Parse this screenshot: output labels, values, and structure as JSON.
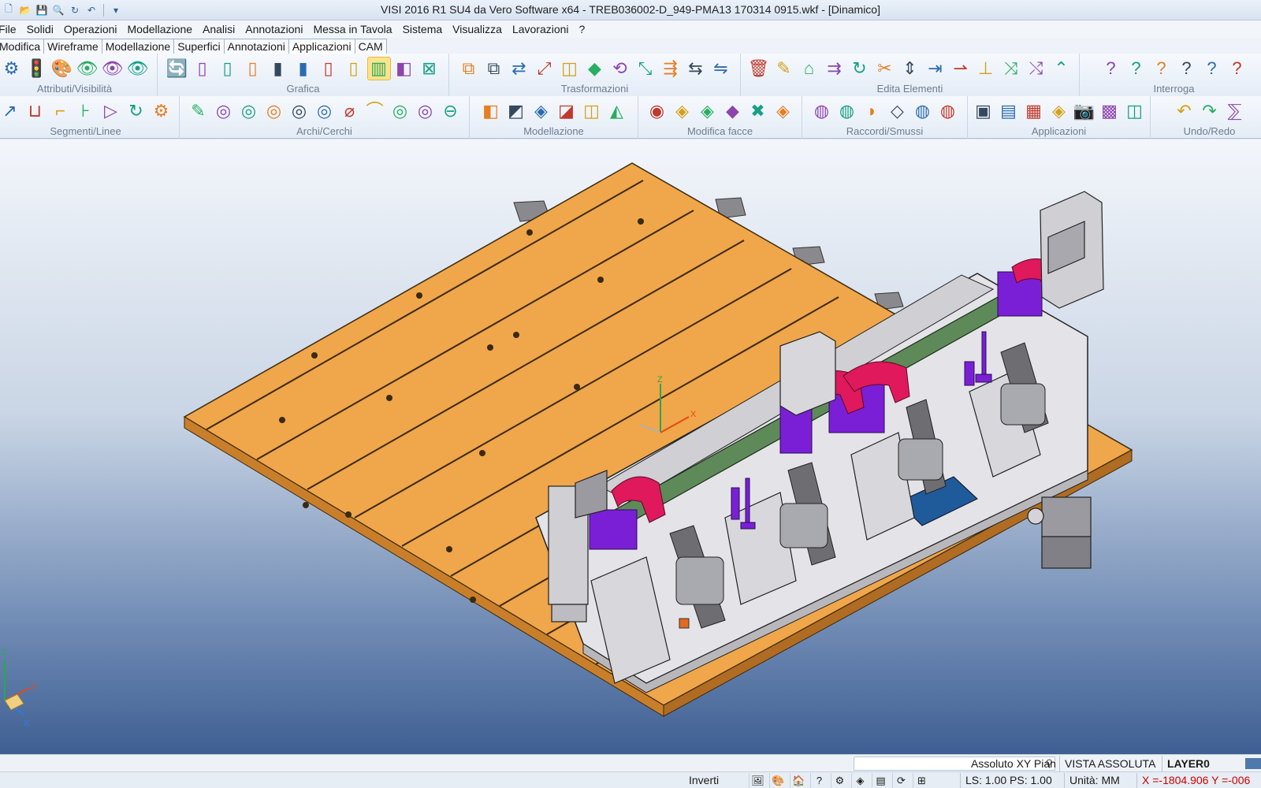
{
  "app": {
    "title": "VISI 2016 R1 SU4 da Vero Software x64 - TREB036002-D_949-PMA13 170314 0915.wkf - [Dinamico]",
    "quick_access": [
      {
        "name": "new-file-icon",
        "glyph": "🗋"
      },
      {
        "name": "open-file-icon",
        "glyph": "📂"
      },
      {
        "name": "save-icon",
        "glyph": "💾"
      },
      {
        "name": "zoom-icon",
        "glyph": "🔍"
      },
      {
        "name": "redraw-icon",
        "glyph": "↻"
      },
      {
        "name": "undo-icon",
        "glyph": "↶"
      },
      {
        "name": "customize-dropdown-icon",
        "glyph": "▾"
      }
    ]
  },
  "menu": [
    "File",
    "Solidi",
    "Operazioni",
    "Modellazione",
    "Analisi",
    "Annotazioni",
    "Messa in Tavola",
    "Sistema",
    "Visualizza",
    "Lavorazioni",
    "?"
  ],
  "tabs": [
    {
      "label": "Modifica",
      "active": false
    },
    {
      "label": "Wireframe",
      "active": false
    },
    {
      "label": "Modellazione",
      "active": false
    },
    {
      "label": "Superfici",
      "active": false
    },
    {
      "label": "Annotazioni",
      "active": false
    },
    {
      "label": "Applicazioni",
      "active": true
    },
    {
      "label": "CAM",
      "active": false
    }
  ],
  "ribbon_row1": [
    {
      "label": "Attributi/Visibilità",
      "icons": [
        "⚙",
        "🚦",
        "🎨",
        "👁",
        "👁",
        "👁"
      ]
    },
    {
      "label": "Grafica",
      "icons": [
        "🔄",
        "▯",
        "▯",
        "▯",
        "▮",
        "▮",
        "▯",
        "▯",
        "▥",
        "◧",
        "⊠"
      ],
      "highlight": 8
    },
    {
      "label": "Trasformazioni",
      "icons": [
        "⧉",
        "⧉",
        "⇄",
        "⤢",
        "◫",
        "◆",
        "⟲",
        "⤡",
        "⇶",
        "⇆",
        "⇋"
      ]
    },
    {
      "label": "Edita Elementi",
      "icons": [
        "🗑",
        "✎",
        "⌂",
        "⇉",
        "↻",
        "✂",
        "⇕",
        "⇥",
        "⇀",
        "⊥",
        "⤨",
        "⤭",
        "⌃"
      ]
    },
    {
      "label": "Interroga",
      "icons": [
        "?",
        "?",
        "?",
        "?",
        "?",
        "?"
      ]
    }
  ],
  "ribbon_row2": [
    {
      "label": "Segmenti/Linee",
      "icons": [
        "↗",
        "⊔",
        "⌐",
        "⊦",
        "▷",
        "↻",
        "⚙"
      ]
    },
    {
      "label": "Archi/Cerchi",
      "icons": [
        "✎",
        "◎",
        "◎",
        "◎",
        "◎",
        "◎",
        "⌀",
        "⌒",
        "◎",
        "◎",
        "⊖"
      ]
    },
    {
      "label": "Modellazione",
      "icons": [
        "◧",
        "◩",
        "◈",
        "◪",
        "◫",
        "◭"
      ]
    },
    {
      "label": "Modifica facce",
      "icons": [
        "◉",
        "◈",
        "◈",
        "◆",
        "✖",
        "◈"
      ]
    },
    {
      "label": "Raccordi/Smussi",
      "icons": [
        "◍",
        "◍",
        "◗",
        "◇",
        "◍",
        "◍"
      ]
    },
    {
      "label": "Applicazioni",
      "icons": [
        "▣",
        "▤",
        "▦",
        "◈",
        "📷",
        "▩",
        "◫"
      ]
    },
    {
      "label": "Undo/Redo",
      "icons": [
        "↶",
        "↷",
        "⅀"
      ]
    }
  ],
  "status_top": {
    "search_value": "",
    "plane": "Assoluto XY Pian",
    "view": "VISTA ASSOLUTA",
    "layer": "LAYER0"
  },
  "status_bottom": {
    "inverti": "Inverti",
    "icons": [
      "🖼",
      "🎨",
      "🏠",
      "?",
      "⚙",
      "◈",
      "▤",
      "⟳",
      "⊞"
    ],
    "scale": "LS: 1.00 PS: 1.00",
    "units": "Unità: MM",
    "coords": "X =-1804.906 Y =-006",
    "coords_color": "#cc0000"
  },
  "colors": {
    "plate": "#f0a64a",
    "fixture_steel": "#d8d8dc",
    "clamp_pink": "#e0185c",
    "clamp_purple": "#7b1fd6",
    "bar_green": "#5e8a5a",
    "dark_grey": "#6e6e72",
    "highlight_yellow": "#fde38a"
  }
}
